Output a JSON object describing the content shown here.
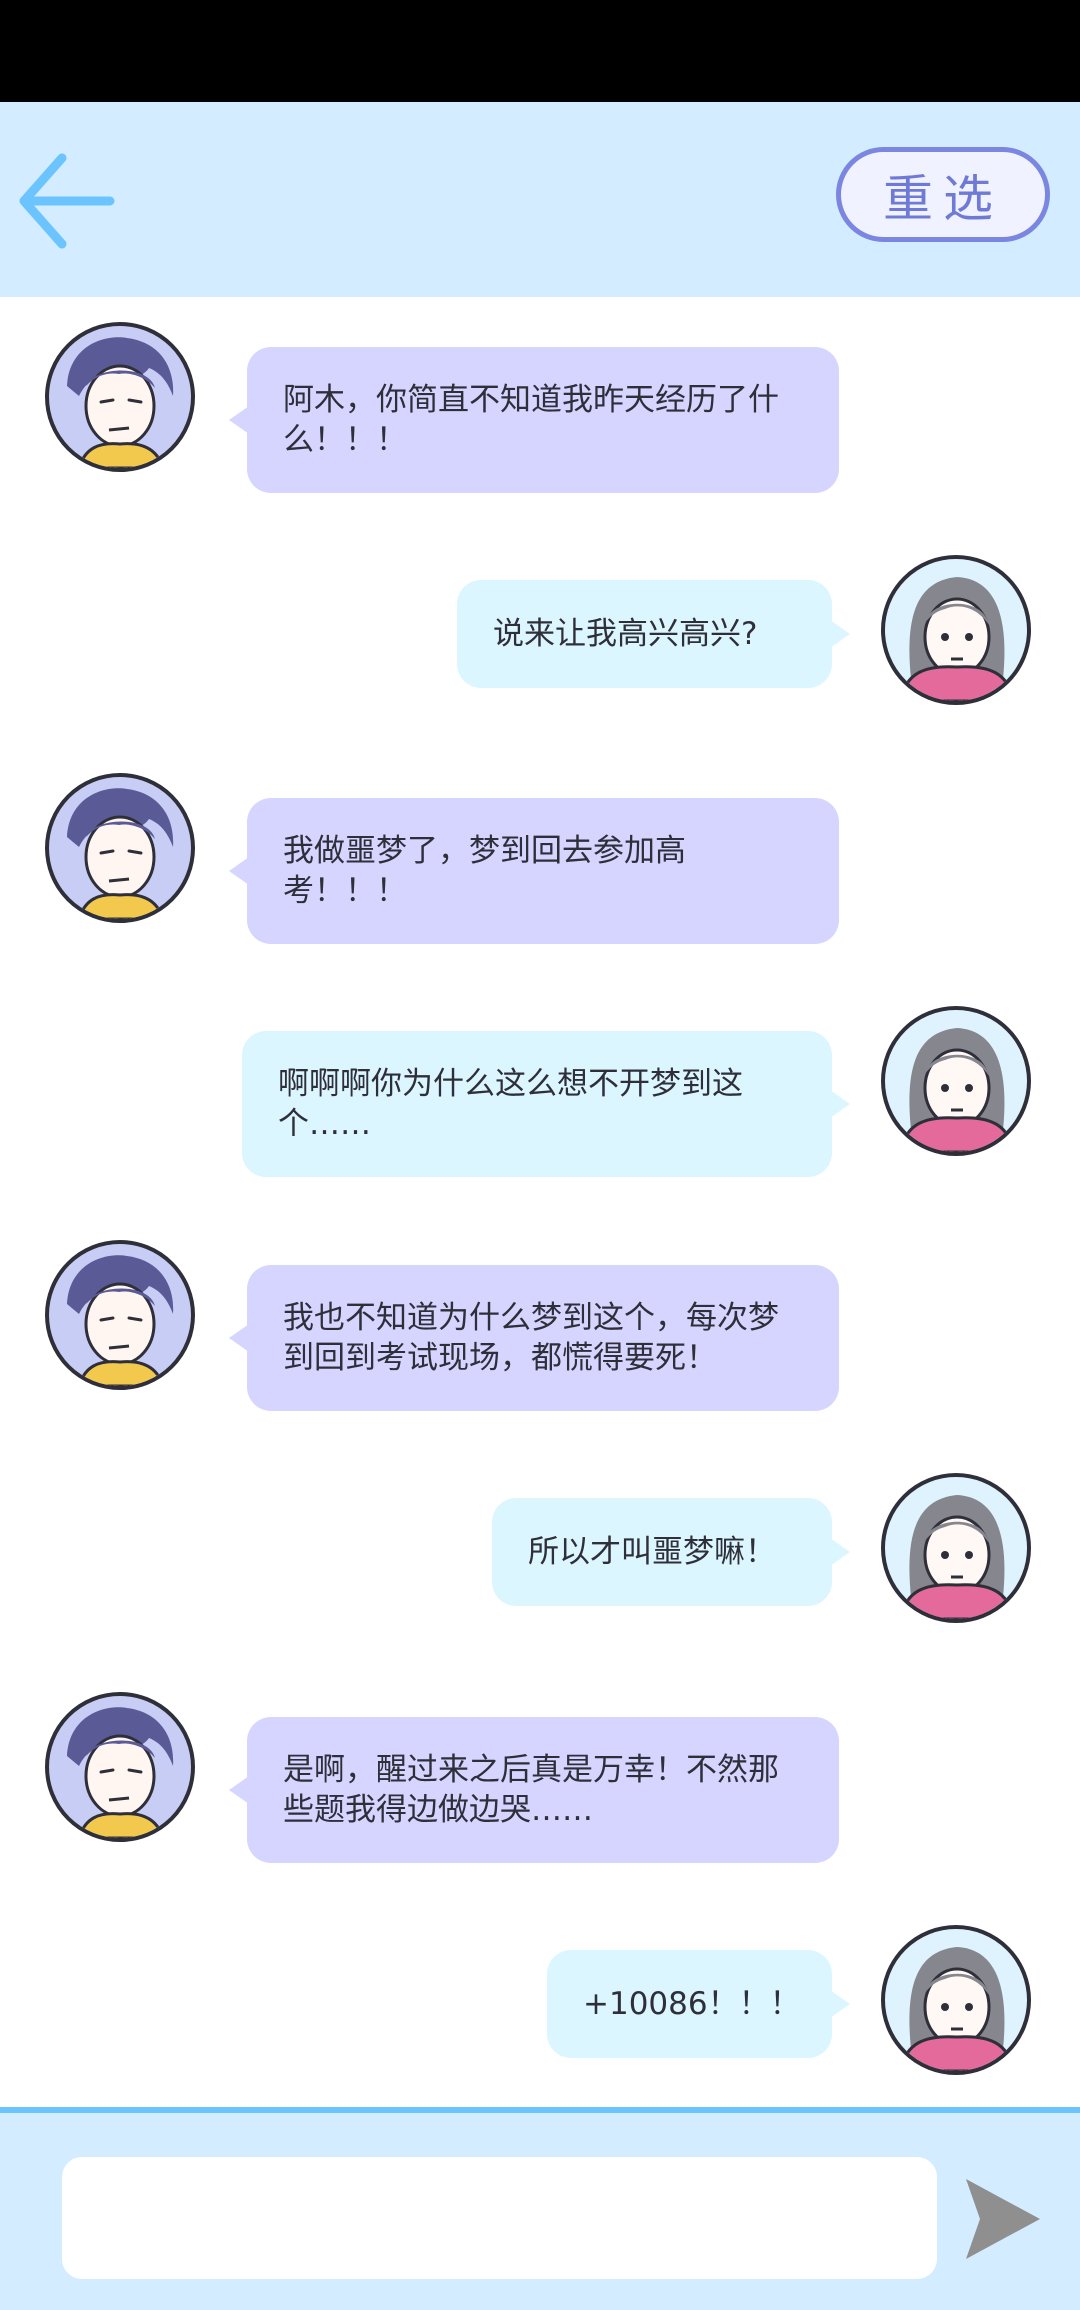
{
  "header": {
    "reselect_label": "重选"
  },
  "messages": [
    {
      "side": "left",
      "text": "阿木，你简直不知道我昨天经历了什么！！！"
    },
    {
      "side": "right",
      "text": "说来让我高兴高兴?"
    },
    {
      "side": "left",
      "text": "我做噩梦了，梦到回去参加高考！！！"
    },
    {
      "side": "right",
      "text": "啊啊啊你为什么这么想不开梦到这个……"
    },
    {
      "side": "left",
      "text": "我也不知道为什么梦到这个，每次梦到回到考试现场，都慌得要死！"
    },
    {
      "side": "right",
      "text": "所以才叫噩梦嘛！"
    },
    {
      "side": "left",
      "text": "是啊，醒过来之后真是万幸！不然那些题我得边做边哭……"
    },
    {
      "side": "right",
      "text": "+10086！！！"
    }
  ],
  "composer": {
    "input_value": "",
    "placeholder": ""
  },
  "colors": {
    "header_bg": "#d3ecff",
    "left_bubble": "#d5d5ff",
    "right_bubble": "#dcf6ff",
    "accent": "#6cc4ff",
    "reselect_border": "#7a86e0"
  },
  "icons": {
    "back": "arrow-left-icon",
    "send": "send-icon",
    "avatar_left": "male-avatar",
    "avatar_right": "female-avatar"
  }
}
